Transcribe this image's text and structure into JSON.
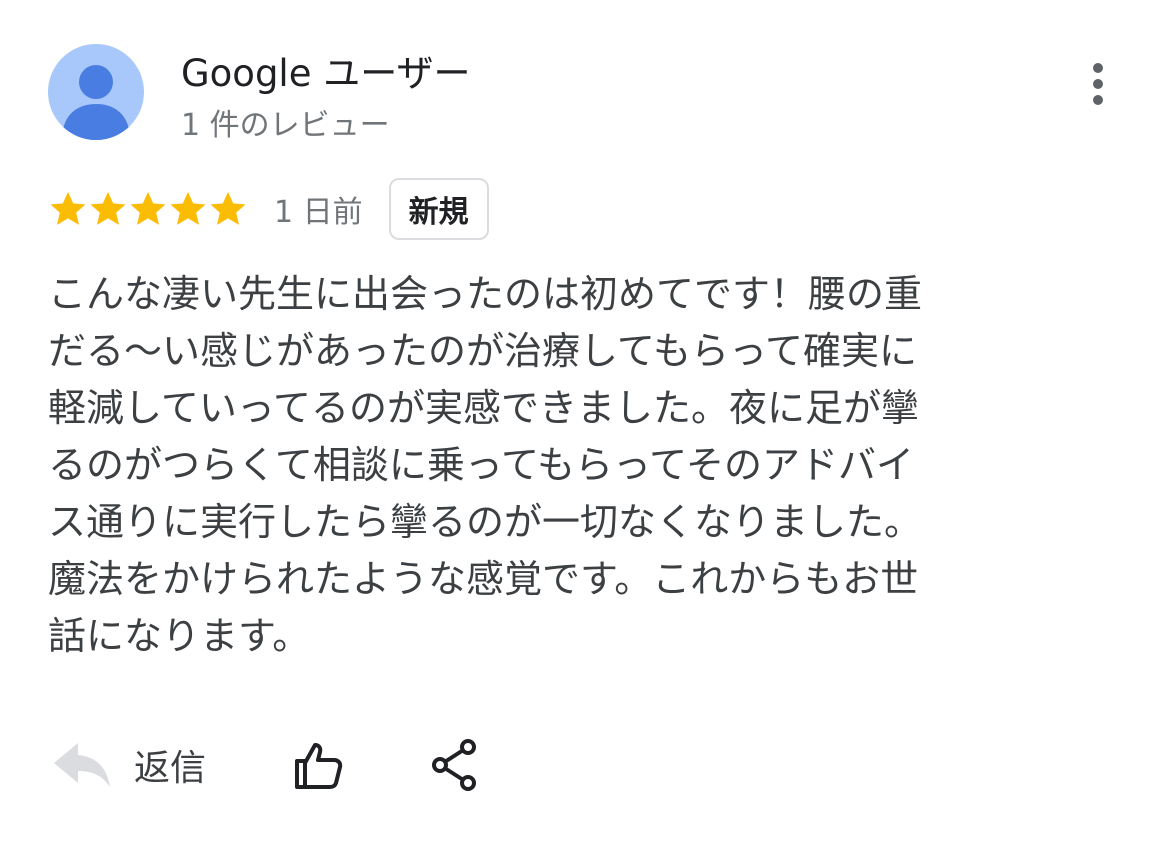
{
  "reviewer": {
    "name": "Google ユーザー",
    "review_count": "1 件のレビュー",
    "avatar_icon": "person-icon",
    "avatar_color": "#a8c7fa"
  },
  "menu": {
    "icon": "more-vertical-icon"
  },
  "rating": {
    "stars": 5,
    "max_stars": 5,
    "star_color": "#fbbc04",
    "time_ago": "1 日前",
    "badge": "新規"
  },
  "review": {
    "lines": [
      "こんな凄い先生に出会ったのは初めてです！腰の重",
      "だる〜い感じがあったのが治療してもらって確実に",
      "軽減していってるのが実感できました。夜に足が攣",
      "るのがつらくて相談に乗ってもらってそのアドバイ",
      "ス通りに実行したら攣るのが一切なくなりました。",
      "魔法をかけられたような感覚です。これからもお世",
      "話になります。"
    ]
  },
  "actions": {
    "reply_icon": "reply-arrow-icon",
    "reply_label": "返信",
    "like_icon": "thumbs-up-icon",
    "share_icon": "share-icon"
  }
}
